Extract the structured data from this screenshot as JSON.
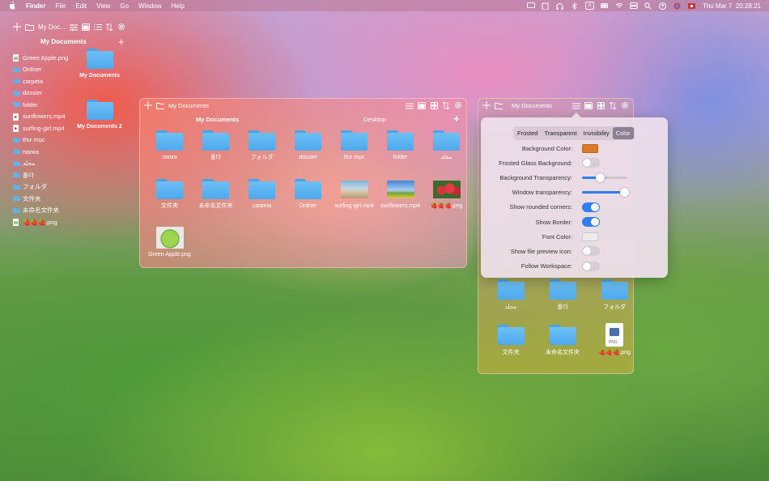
{
  "menubar": {
    "app": "Finder",
    "items": [
      "File",
      "Edit",
      "View",
      "Go",
      "Window",
      "Help"
    ],
    "clock": "Thu Mar 7  20:28:21",
    "input_indicator": "A"
  },
  "left_panel": {
    "toolbar_title": "My Doc...",
    "header": "My Documents",
    "files": [
      {
        "name": "Green Apple.png",
        "icon": "image-file-icon"
      },
      {
        "name": "Ordner",
        "icon": "folder-icon"
      },
      {
        "name": "carpeta",
        "icon": "folder-icon"
      },
      {
        "name": "dossier",
        "icon": "folder-icon"
      },
      {
        "name": "folder",
        "icon": "folder-icon"
      },
      {
        "name": "sunflowers.mp4",
        "icon": "video-file-icon"
      },
      {
        "name": "surfing-girl.mp4",
        "icon": "video-file-icon"
      },
      {
        "name": "thư mục",
        "icon": "folder-icon"
      },
      {
        "name": "папка",
        "icon": "folder-icon"
      },
      {
        "name": "مجلد",
        "icon": "folder-icon"
      },
      {
        "name": "폴더",
        "icon": "folder-icon"
      },
      {
        "name": "フォルダ",
        "icon": "folder-icon"
      },
      {
        "name": "文件夹",
        "icon": "folder-icon"
      },
      {
        "name": "未命名文件夹",
        "icon": "folder-icon"
      },
      {
        "name": "🍓🍓🍓.png",
        "icon": "image-file-icon"
      }
    ],
    "big_folders": [
      "My Documents",
      "My Documents 2"
    ]
  },
  "window1": {
    "title": "My Documents",
    "tabs": [
      "My Documents",
      "Desktop"
    ],
    "items": [
      {
        "label": "папка",
        "kind": "folder"
      },
      {
        "label": "폴더",
        "kind": "folder"
      },
      {
        "label": "フォルダ",
        "kind": "folder"
      },
      {
        "label": "dossier",
        "kind": "folder"
      },
      {
        "label": "thư mục",
        "kind": "folder"
      },
      {
        "label": "folder",
        "kind": "folder"
      },
      {
        "label": "مجلد",
        "kind": "folder"
      },
      {
        "label": "文件夹",
        "kind": "folder"
      },
      {
        "label": "未命名文件夹",
        "kind": "folder"
      },
      {
        "label": "carpeta",
        "kind": "folder"
      },
      {
        "label": "Ordner",
        "kind": "folder"
      },
      {
        "label": "surfing-girl.mp4",
        "kind": "surf"
      },
      {
        "label": "sunflowers.mp4",
        "kind": "sky"
      },
      {
        "label": "🍓🍓🍓.png",
        "kind": "berry"
      },
      {
        "label": "Green Apple.png",
        "kind": "apple"
      }
    ]
  },
  "window2": {
    "title": "My Documents",
    "items": [
      {
        "label": "مجلد",
        "kind": "folder"
      },
      {
        "label": "폴더",
        "kind": "folder"
      },
      {
        "label": "フォルダ",
        "kind": "folder"
      },
      {
        "label": "文件夹",
        "kind": "folder"
      },
      {
        "label": "未命名文件夹",
        "kind": "folder"
      },
      {
        "label": "🍓🍓🍓.png",
        "kind": "png"
      }
    ]
  },
  "settings": {
    "tabs": [
      "Frosted",
      "Transparent",
      "Invisibility",
      "Color"
    ],
    "active_tab": "Color",
    "rows": [
      {
        "label": "Background Color:",
        "type": "color",
        "value": "#d97a28"
      },
      {
        "label": "Frosted Glass Background:",
        "type": "toggle",
        "value": false
      },
      {
        "label": "Background Transparency:",
        "type": "slider",
        "value": 0.4
      },
      {
        "label": "Window transparency:",
        "type": "slider",
        "value": 0.93
      },
      {
        "label": "Show rounded corners:",
        "type": "toggle",
        "value": true
      },
      {
        "label": "Show Border:",
        "type": "toggle",
        "value": true
      },
      {
        "label": "Font Color:",
        "type": "color",
        "value": "#ececec"
      },
      {
        "label": "Show file preview icon:",
        "type": "toggle",
        "value": false
      },
      {
        "label": "Follow Workspace:",
        "type": "toggle",
        "value": false
      }
    ]
  },
  "colors": {
    "accent": "#2f7ff0",
    "folder": "#5cb3f0",
    "segment_active": "#8b7f93"
  }
}
